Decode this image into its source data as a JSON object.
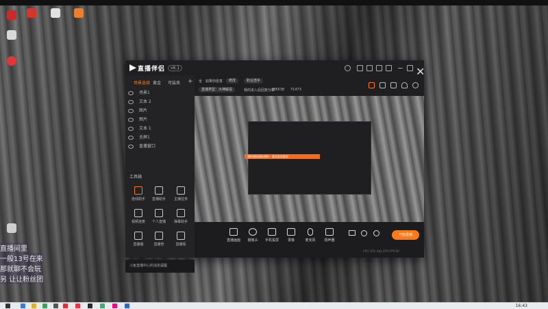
{
  "desktop": {
    "left_lines": [
      "直播间里",
      "一般13号在来",
      "那就聊不会玩",
      "另 让让粉丝团"
    ],
    "icons": [
      {
        "name": "desktop-icon-1",
        "color": "#d9342b"
      },
      {
        "name": "desktop-icon-2",
        "color": "#e2e2e2"
      },
      {
        "name": "desktop-icon-3",
        "color": "#ef7d2a"
      },
      {
        "name": "desktop-icon-4",
        "color": "#cc2a2a"
      },
      {
        "name": "desktop-icon-5",
        "color": "#d9d9d9"
      },
      {
        "name": "desktop-icon-6",
        "color": "#e3363b"
      },
      {
        "name": "desktop-icon-7",
        "color": "#cfcfcf"
      }
    ]
  },
  "app": {
    "logo_text": "直播伴侣",
    "version": "v6.1",
    "sidebar": {
      "tabs": [
        "场景选择",
        "黄金",
        "可装卖"
      ],
      "scenes": [
        "场景1",
        "文本 2",
        "图片",
        "图片",
        "文本 1",
        "全屏1",
        "直播窗口"
      ],
      "tools_title": "工具箱",
      "tools": [
        "连线助手",
        "直播助手",
        "主播任务",
        "视频连麦",
        "个人直播",
        "弹幕助手",
        "直播版",
        "直播管",
        "直播看"
      ],
      "notice": "斗鱼直播中心的消息提醒"
    },
    "top": {
      "label": "全",
      "title": "如果你愿意",
      "edit": "修改",
      "tag": "职业选手",
      "info_left": "直播类型：大神解说",
      "info_mid": "我的进入后回复分享",
      "count": "286538",
      "fans": "71473"
    },
    "preview": {
      "banner": "想你想你想你想你 · 爱你爱你爱你"
    },
    "controls": {
      "items": [
        "直播画面",
        "摄像头",
        "手机投屏",
        "录像",
        "麦克风",
        "扬声器"
      ],
      "start": "开始直播",
      "status": "CPU 32% 内存 45% FPS 60"
    }
  },
  "taskbar": {
    "time": "16:43"
  }
}
